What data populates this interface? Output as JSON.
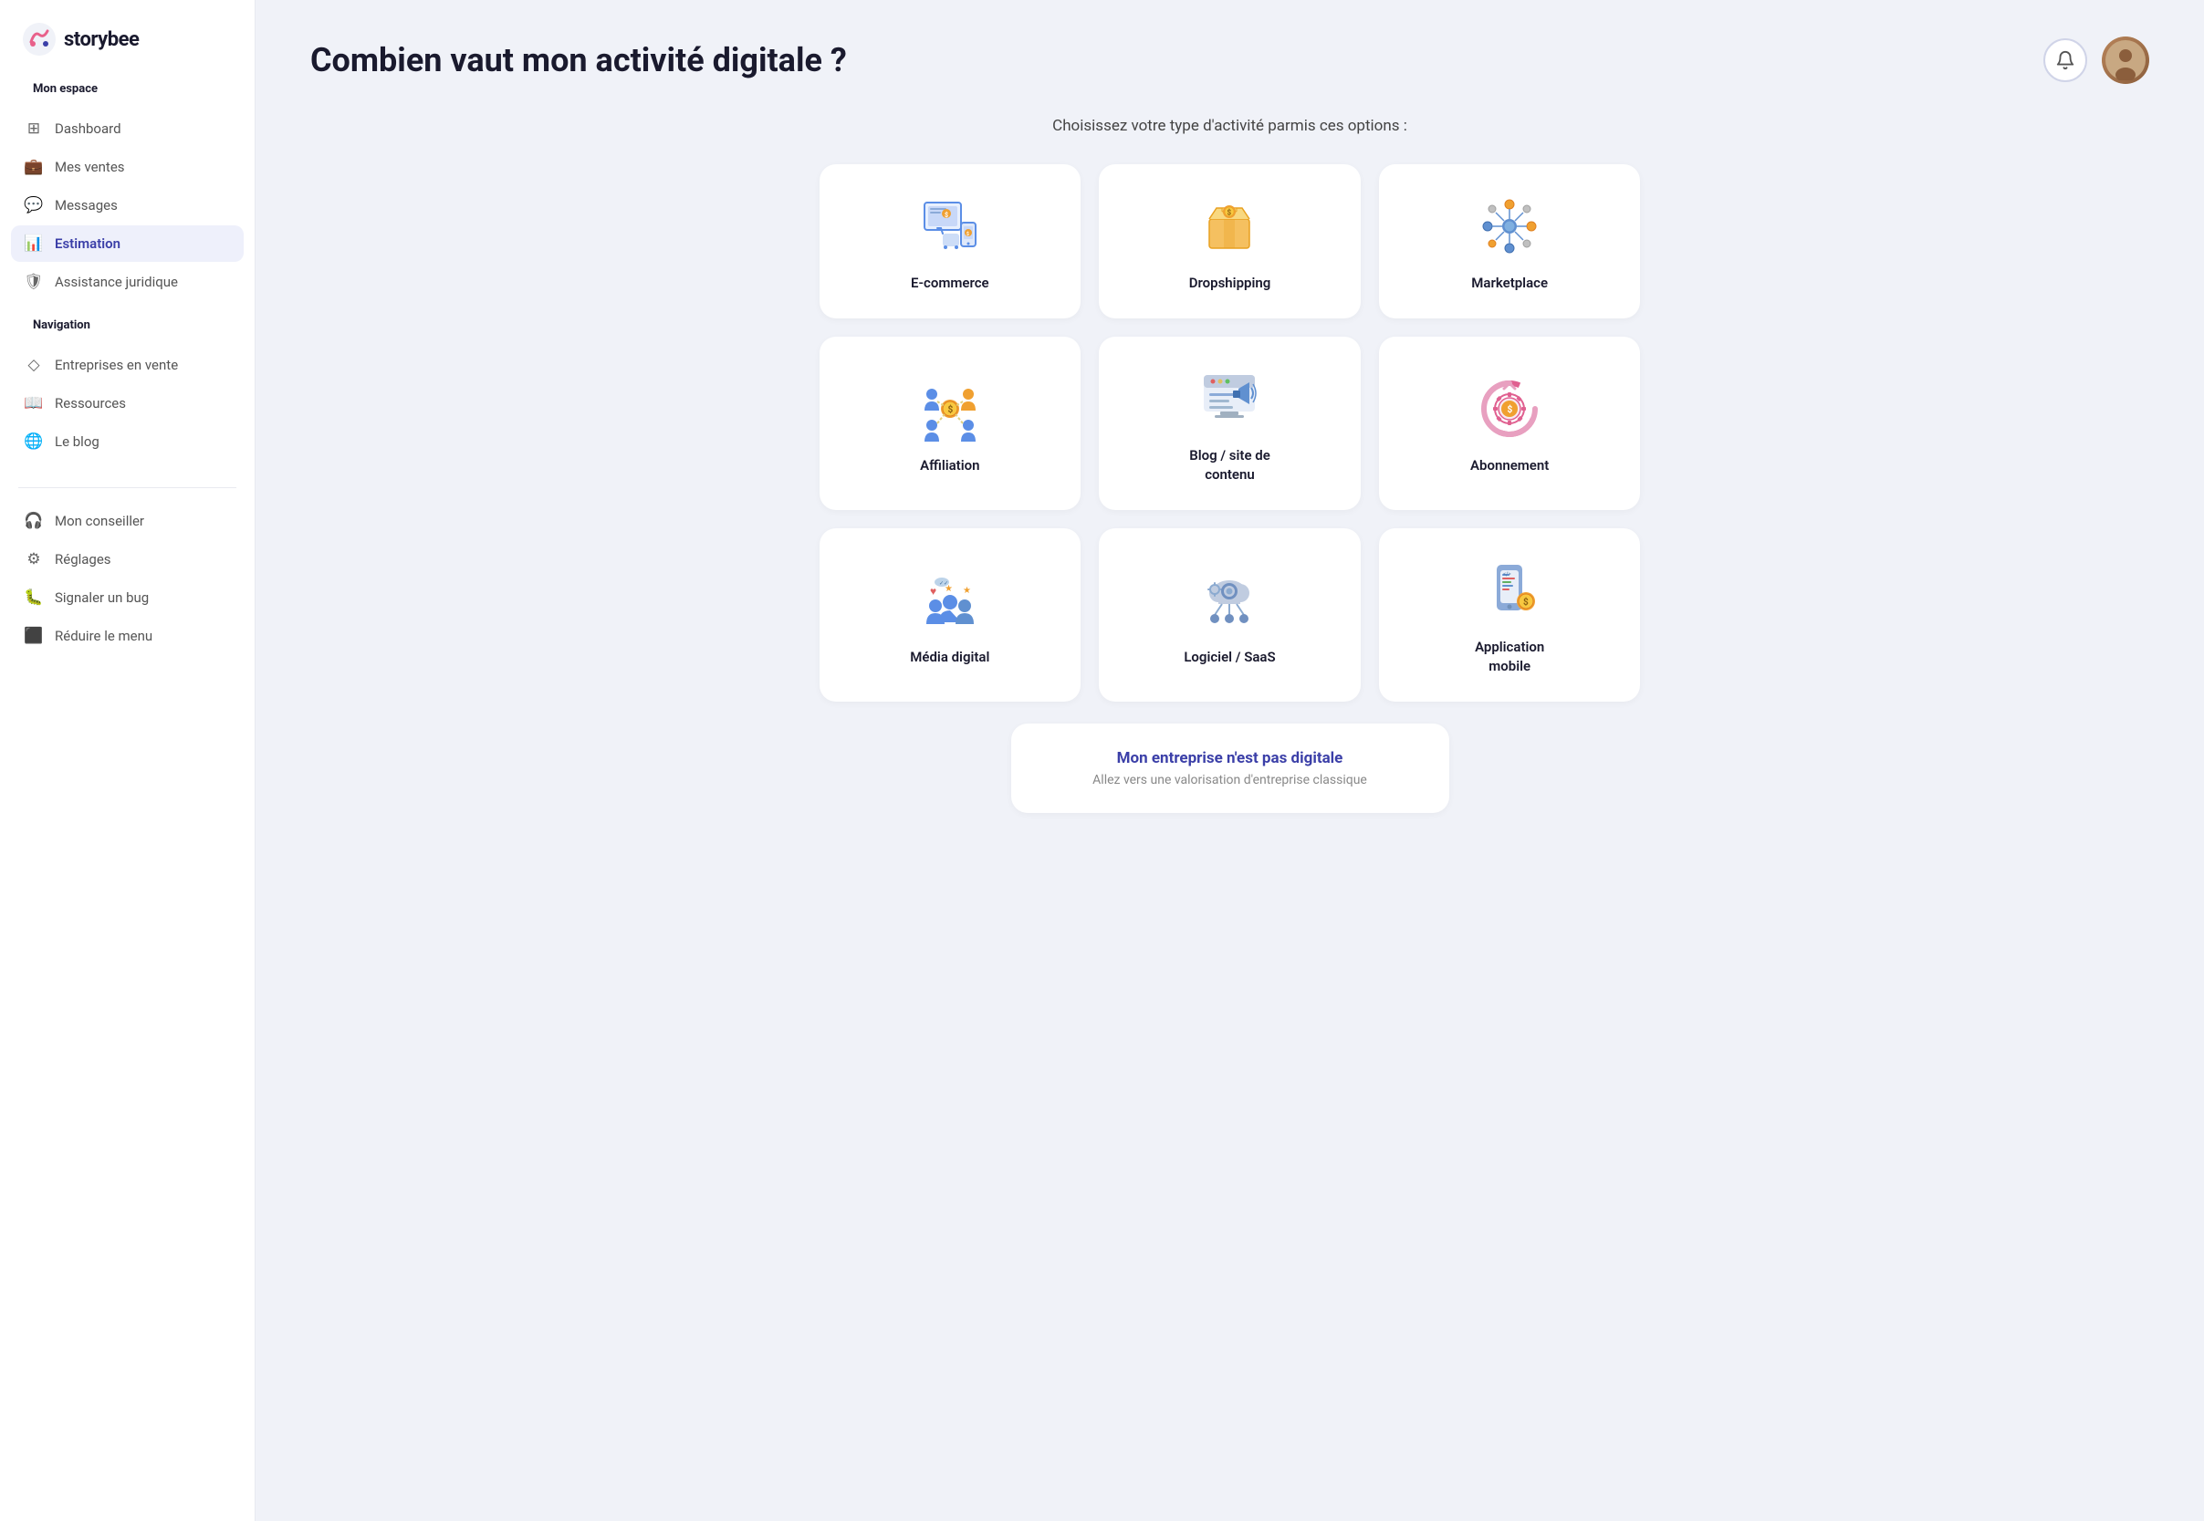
{
  "logo": {
    "text": "storybee"
  },
  "sidebar": {
    "mon_espace_title": "Mon espace",
    "navigation_title": "Navigation",
    "mon_espace_items": [
      {
        "label": "Dashboard",
        "icon": "dashboard-icon",
        "active": false
      },
      {
        "label": "Mes ventes",
        "icon": "sales-icon",
        "active": false
      },
      {
        "label": "Messages",
        "icon": "messages-icon",
        "active": false
      },
      {
        "label": "Estimation",
        "icon": "estimation-icon",
        "active": true
      },
      {
        "label": "Assistance juridique",
        "icon": "legal-icon",
        "active": false
      }
    ],
    "navigation_items": [
      {
        "label": "Entreprises en vente",
        "icon": "tag-icon",
        "active": false
      },
      {
        "label": "Ressources",
        "icon": "book-icon",
        "active": false
      },
      {
        "label": "Le blog",
        "icon": "globe-icon",
        "active": false
      }
    ],
    "bottom_items": [
      {
        "label": "Mon conseiller",
        "icon": "headset-icon",
        "active": false
      },
      {
        "label": "Réglages",
        "icon": "settings-icon",
        "active": false
      },
      {
        "label": "Signaler un bug",
        "icon": "bug-icon",
        "active": false
      },
      {
        "label": "Réduire le menu",
        "icon": "reduce-icon",
        "active": false
      }
    ]
  },
  "main": {
    "page_title": "Combien vaut mon activité digitale ?",
    "subtitle": "Choisissez votre type d'activité parmis ces options :",
    "activity_cards": [
      {
        "id": "ecommerce",
        "label": "E-commerce"
      },
      {
        "id": "dropshipping",
        "label": "Dropshipping"
      },
      {
        "id": "marketplace",
        "label": "Marketplace"
      },
      {
        "id": "affiliation",
        "label": "Affiliation"
      },
      {
        "id": "blog",
        "label": "Blog / site de\ncontenu"
      },
      {
        "id": "abonnement",
        "label": "Abonnement"
      },
      {
        "id": "media",
        "label": "Média digital"
      },
      {
        "id": "logiciel",
        "label": "Logiciel / SaaS"
      },
      {
        "id": "app",
        "label": "Application\nmobile"
      }
    ],
    "bottom_card": {
      "title": "Mon entreprise n'est pas digitale",
      "subtitle": "Allez vers une valorisation d'entreprise classique"
    }
  }
}
